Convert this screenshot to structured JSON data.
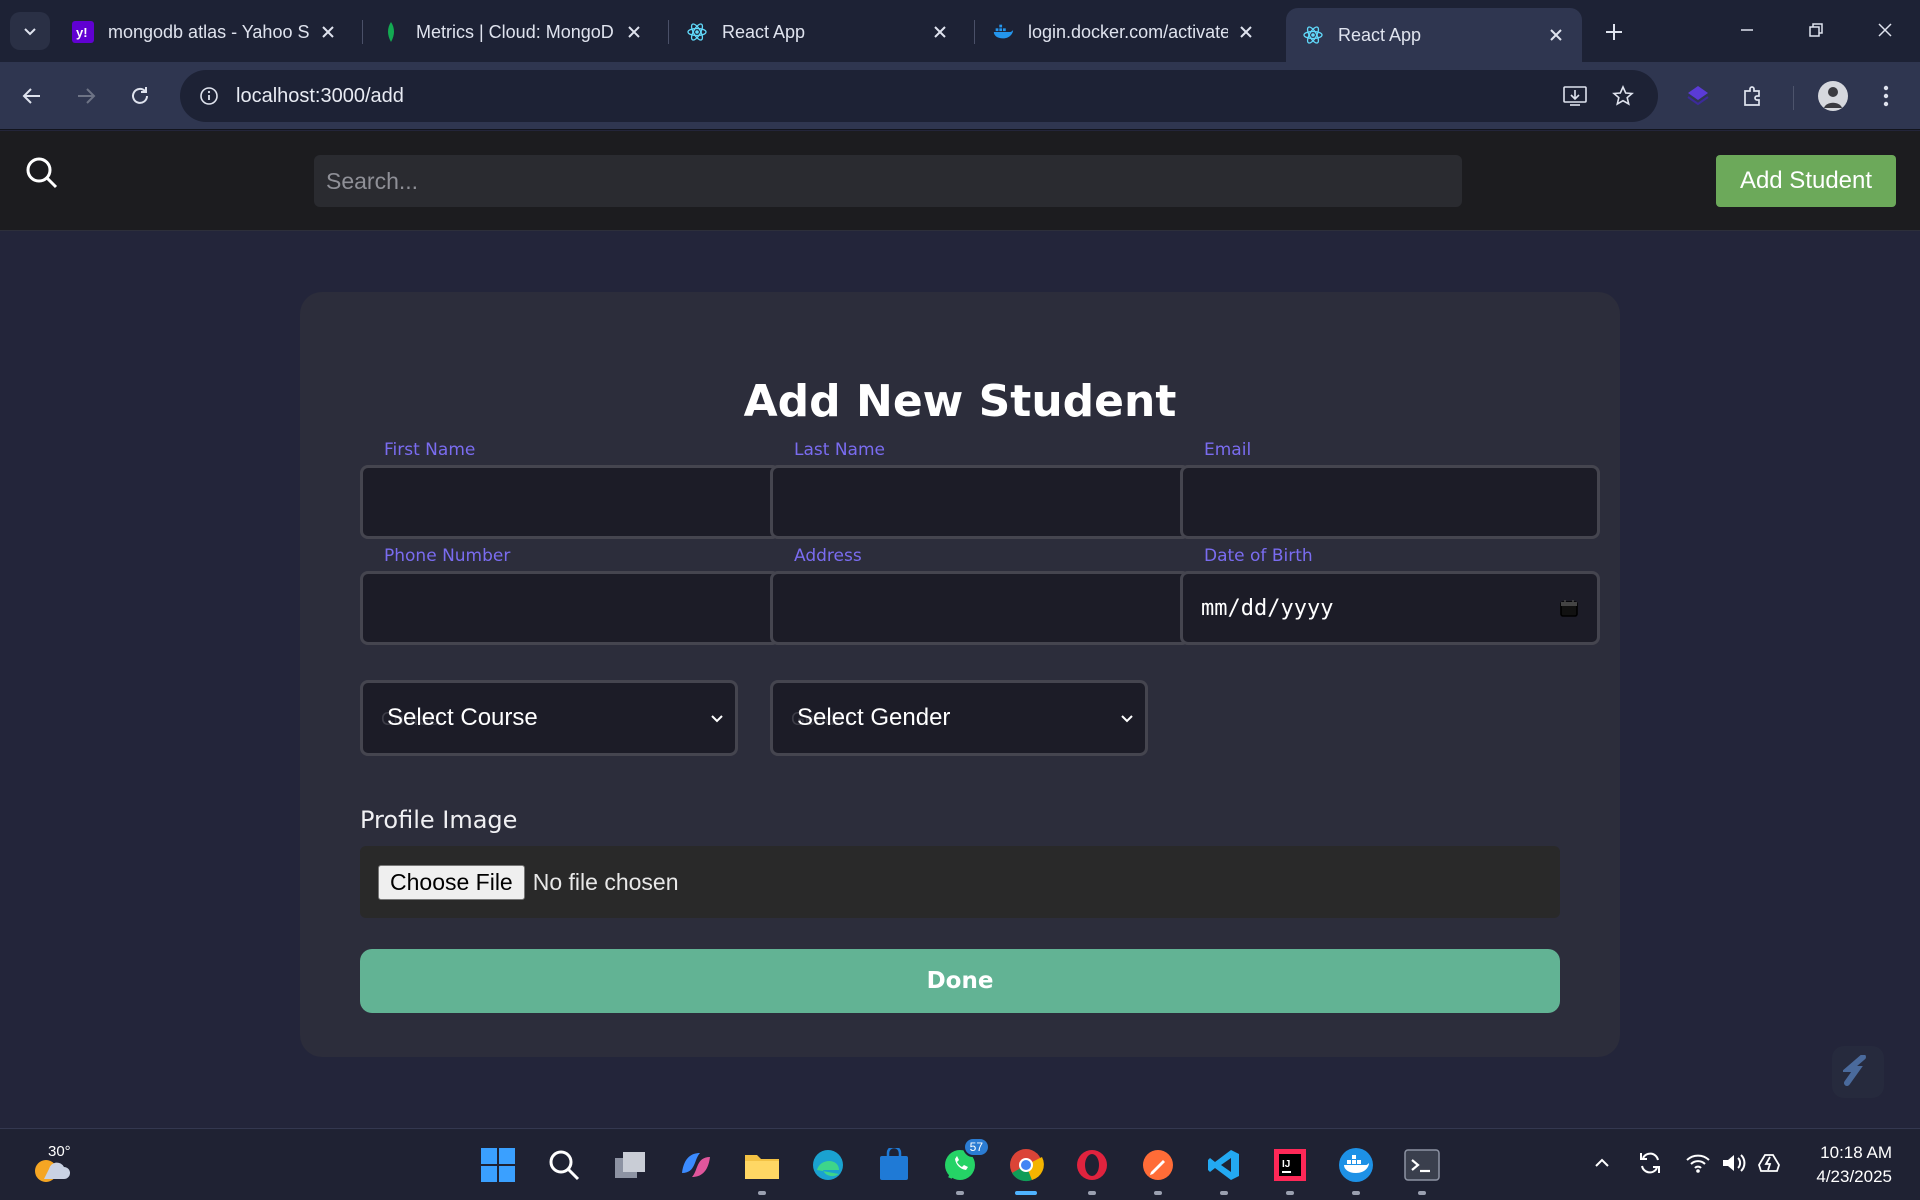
{
  "browser": {
    "tabs": [
      {
        "title": "mongodb atlas - Yahoo S",
        "icon": "yahoo-icon"
      },
      {
        "title": "Metrics | Cloud: MongoD",
        "icon": "mongodb-leaf-icon"
      },
      {
        "title": "React App",
        "icon": "react-icon"
      },
      {
        "title": "login.docker.com/activate",
        "icon": "docker-icon"
      },
      {
        "title": "React App",
        "icon": "react-icon",
        "active": true
      }
    ],
    "url": "localhost:3000/add"
  },
  "app": {
    "search_placeholder": "Search...",
    "add_button": "Add Student"
  },
  "form": {
    "title": "Add New Student",
    "labels": {
      "first_name": "First Name",
      "last_name": "Last Name",
      "email": "Email",
      "phone": "Phone Number",
      "address": "Address",
      "dob": "Date of Birth"
    },
    "dob_placeholder": "mm/dd/yyyy",
    "course_select": "Select Course",
    "gender_select": "Select Gender",
    "course_ghost": "Course",
    "gender_ghost": "Gender",
    "profile_label": "Profile Image",
    "file_button": "Choose File",
    "file_status": "No file chosen",
    "done_button": "Done"
  },
  "taskbar": {
    "weather_temp": "30°",
    "whatsapp_badge": "57",
    "time": "10:18 AM",
    "date": "4/23/2025"
  },
  "colors": {
    "label_purple": "#7a6cf0",
    "add_button_green": "#6ca95a",
    "done_button_teal": "#62b394",
    "card_bg": "#2c2d3b",
    "page_bg": "#23253a"
  }
}
